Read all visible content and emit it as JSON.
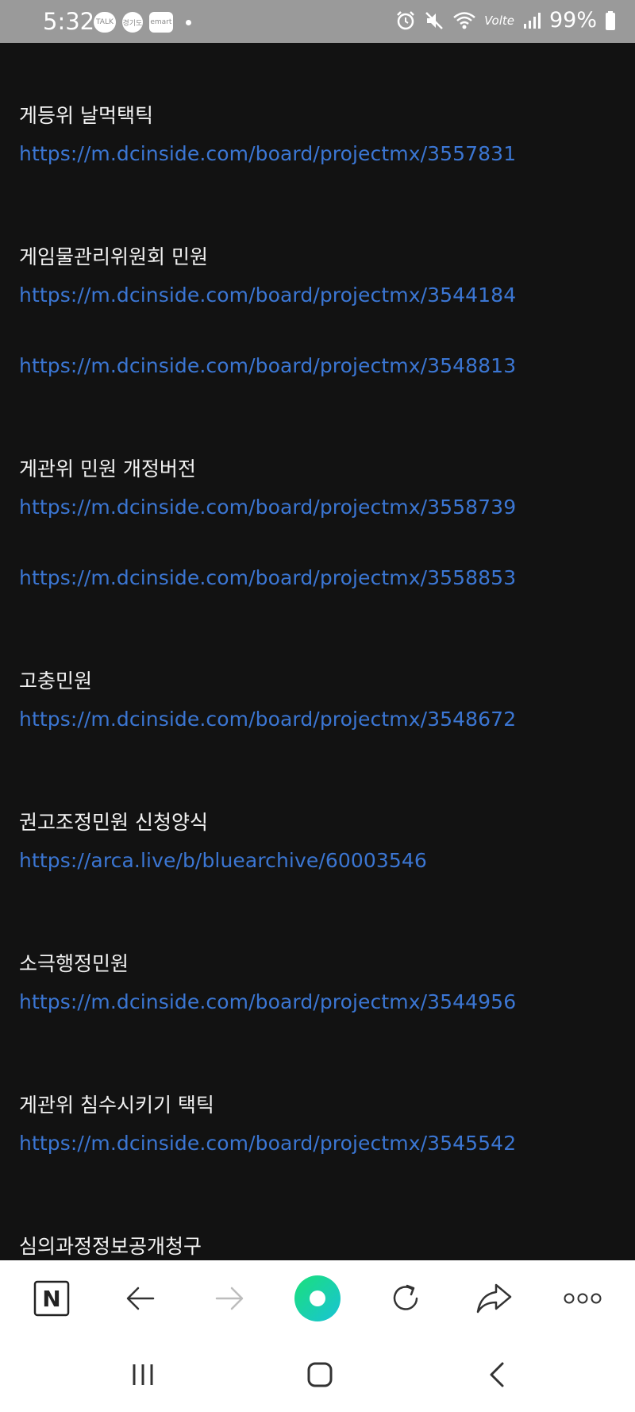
{
  "status_bar": {
    "time": "5:32",
    "notif_talk": "TALK",
    "notif_app": "경기도",
    "notif_emart": "emart",
    "volte": "Volte",
    "battery": "99%"
  },
  "entries": [
    {
      "heading": "게등위 날먹택틱",
      "links": [
        "https://m.dcinside.com/board/projectmx/3557831"
      ]
    },
    {
      "heading": "게임물관리위원회 민원",
      "links": [
        "https://m.dcinside.com/board/projectmx/3544184",
        "https://m.dcinside.com/board/projectmx/3548813"
      ]
    },
    {
      "heading": "게관위 민원 개정버전",
      "links": [
        "https://m.dcinside.com/board/projectmx/3558739",
        "https://m.dcinside.com/board/projectmx/3558853"
      ]
    },
    {
      "heading": "고충민원",
      "links": [
        "https://m.dcinside.com/board/projectmx/3548672"
      ]
    },
    {
      "heading": "권고조정민원 신청양식",
      "links": [
        "https://arca.live/b/bluearchive/60003546"
      ]
    },
    {
      "heading": "소극행정민원",
      "links": [
        "https://m.dcinside.com/board/projectmx/3544956"
      ]
    },
    {
      "heading": "게관위 침수시키기 택틱",
      "links": [
        "https://m.dcinside.com/board/projectmx/3545542"
      ]
    },
    {
      "heading": "심의과정정보공개청구",
      "links": []
    }
  ],
  "toolbar": {
    "icons": [
      "naver-n-icon",
      "back-arrow-icon",
      "forward-arrow-icon",
      "home-green-circle-icon",
      "refresh-icon",
      "share-icon",
      "more-icon"
    ],
    "naver_letter": "N"
  },
  "navbar": {
    "icons": [
      "recent-apps-icon",
      "home-icon",
      "back-icon"
    ]
  },
  "colors": {
    "background": "#121212",
    "link": "#3b76d3",
    "heading": "#f2f2f2",
    "accent_green": "#1fd6a0"
  }
}
